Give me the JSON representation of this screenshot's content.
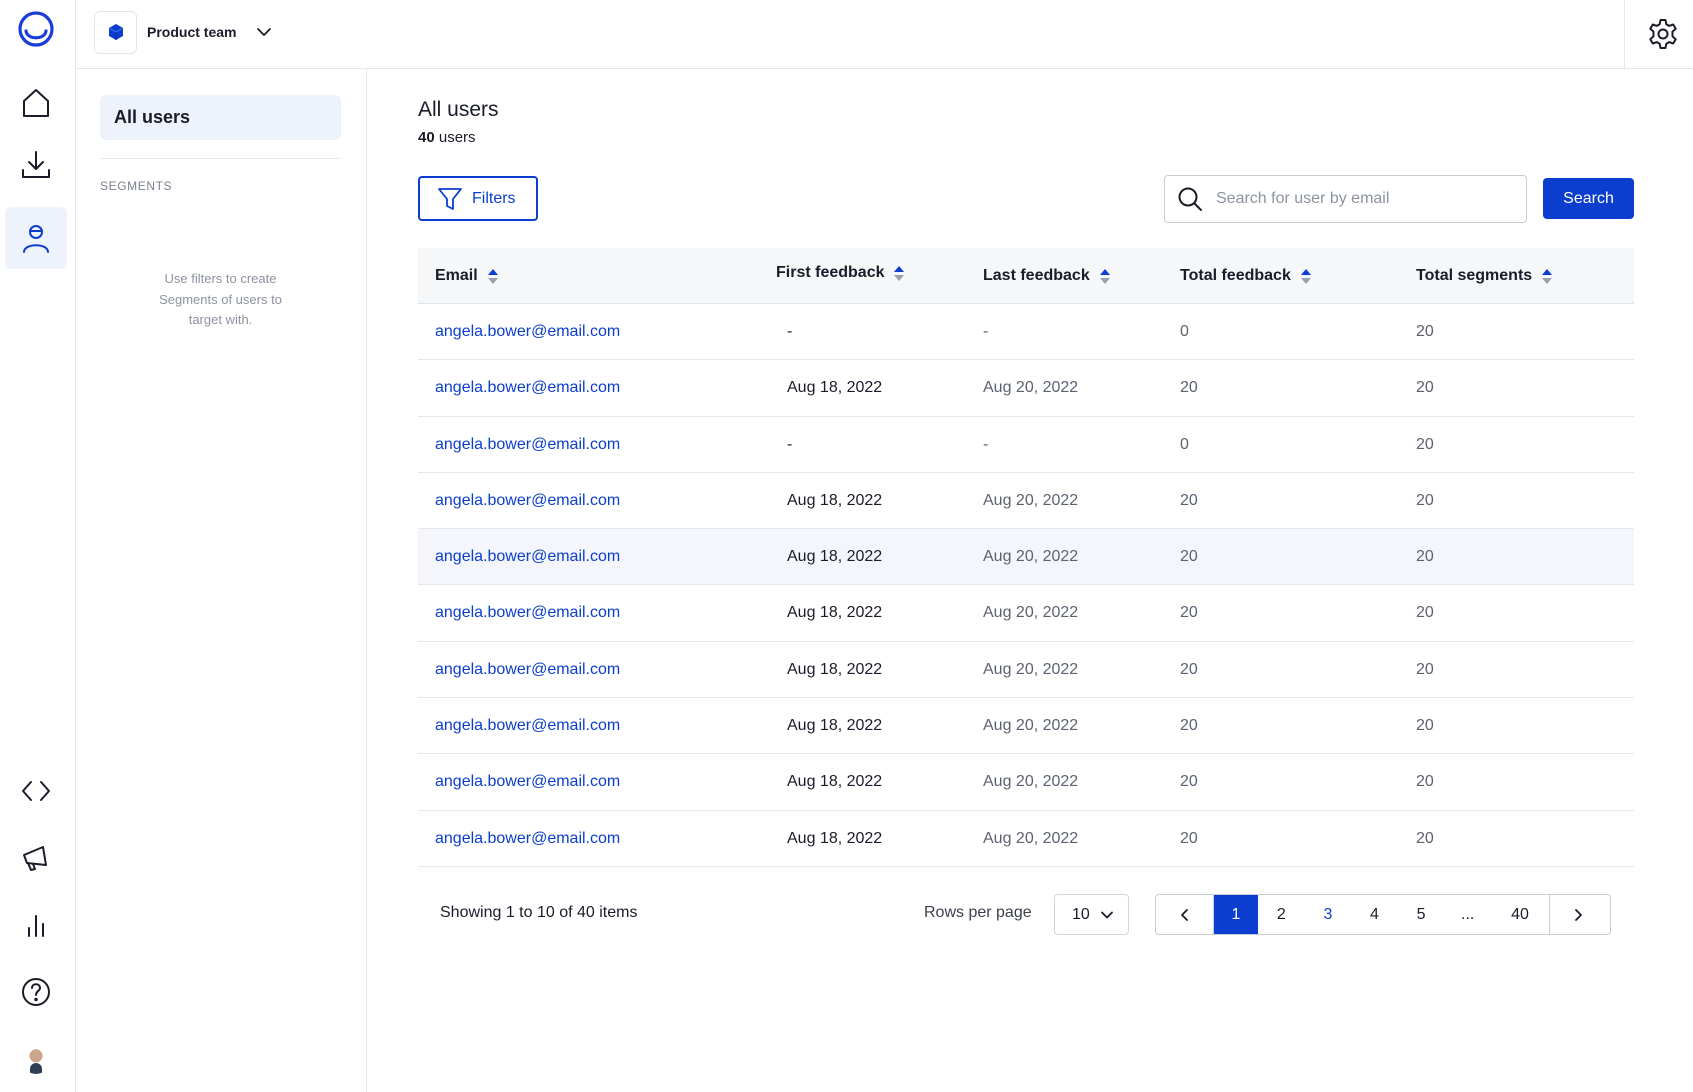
{
  "topbar": {
    "team_name": "Product team"
  },
  "subnav": {
    "all_users": "All users",
    "segments_heading": "SEGMENTS",
    "segments_hint": "Use filters to create\nSegments of users to\ntarget with."
  },
  "main": {
    "title": "All users",
    "count_number": "40",
    "count_suffix": " users",
    "filters_label": "Filters",
    "search_placeholder": "Search for user by email",
    "search_button": "Search"
  },
  "table": {
    "columns": [
      "Email",
      "First feedback",
      "Last feedback",
      "Total feedback",
      "Total segments"
    ],
    "rows": [
      {
        "email": "angela.bower@email.com",
        "first": "-",
        "last": "-",
        "total": "0",
        "segments": "20"
      },
      {
        "email": "angela.bower@email.com",
        "first": "Aug 18, 2022",
        "last": "Aug 20, 2022",
        "total": "20",
        "segments": "20"
      },
      {
        "email": "angela.bower@email.com",
        "first": "-",
        "last": "-",
        "total": "0",
        "segments": "20"
      },
      {
        "email": "angela.bower@email.com",
        "first": "Aug 18, 2022",
        "last": "Aug 20, 2022",
        "total": "20",
        "segments": "20"
      },
      {
        "email": "angela.bower@email.com",
        "first": "Aug 18, 2022",
        "last": "Aug 20, 2022",
        "total": "20",
        "segments": "20"
      },
      {
        "email": "angela.bower@email.com",
        "first": "Aug 18, 2022",
        "last": "Aug 20, 2022",
        "total": "20",
        "segments": "20"
      },
      {
        "email": "angela.bower@email.com",
        "first": "Aug 18, 2022",
        "last": "Aug 20, 2022",
        "total": "20",
        "segments": "20"
      },
      {
        "email": "angela.bower@email.com",
        "first": "Aug 18, 2022",
        "last": "Aug 20, 2022",
        "total": "20",
        "segments": "20"
      },
      {
        "email": "angela.bower@email.com",
        "first": "Aug 18, 2022",
        "last": "Aug 20, 2022",
        "total": "20",
        "segments": "20"
      },
      {
        "email": "angela.bower@email.com",
        "first": "Aug 18, 2022",
        "last": "Aug 20, 2022",
        "total": "20",
        "segments": "20"
      }
    ],
    "highlighted_row": 4
  },
  "footer": {
    "showing": "Showing 1 to 10 of 40 items",
    "rows_per_page_label": "Rows per page",
    "rows_per_page_value": "10",
    "pages": [
      "1",
      "2",
      "3",
      "4",
      "5",
      "...",
      "40"
    ],
    "current_page": "1"
  },
  "icons": {
    "rail_top": [
      "home-icon",
      "download-icon",
      "users-icon"
    ],
    "rail_bottom": [
      "code-icon",
      "megaphone-icon",
      "bar-chart-icon",
      "help-icon"
    ],
    "settings": "gear-icon"
  },
  "colors": {
    "accent": "#0b3ecf",
    "active_bg": "#eef2fb",
    "header_bg": "#f6f7f9",
    "row_highlight": "#f4f6fb"
  }
}
